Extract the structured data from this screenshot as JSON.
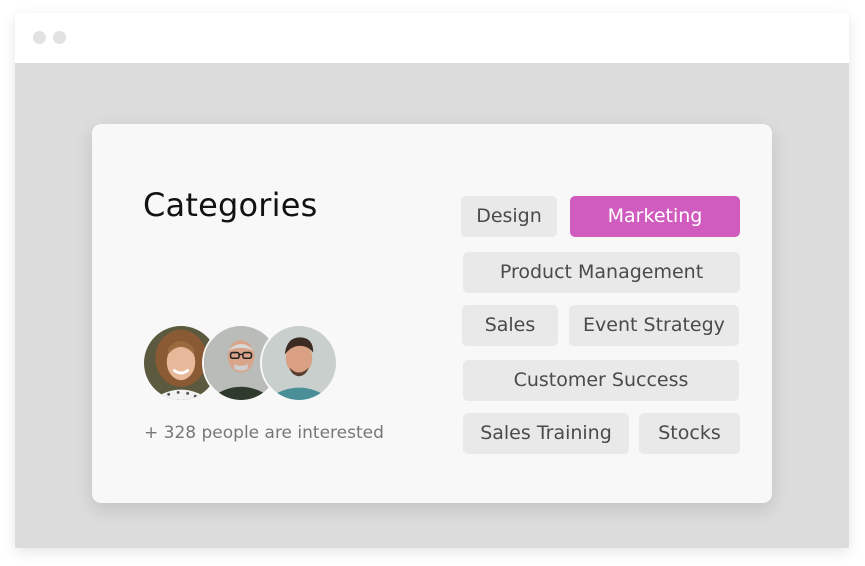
{
  "card": {
    "title": "Categories",
    "interested_text": "+ 328 people are interested"
  },
  "avatars": [
    {
      "name": "woman-avatar"
    },
    {
      "name": "older-man-avatar"
    },
    {
      "name": "young-man-avatar"
    }
  ],
  "tags": [
    {
      "label": "Design",
      "active": false
    },
    {
      "label": "Marketing",
      "active": true
    },
    {
      "label": "Product Management",
      "active": false
    },
    {
      "label": "Sales",
      "active": false
    },
    {
      "label": "Event Strategy",
      "active": false
    },
    {
      "label": "Customer Success",
      "active": false
    },
    {
      "label": "Sales Training",
      "active": false
    },
    {
      "label": "Stocks",
      "active": false
    }
  ],
  "colors": {
    "accent": "#d15cc0",
    "tag_bg": "#e9e9e9",
    "backdrop": "#dcdcdc"
  }
}
